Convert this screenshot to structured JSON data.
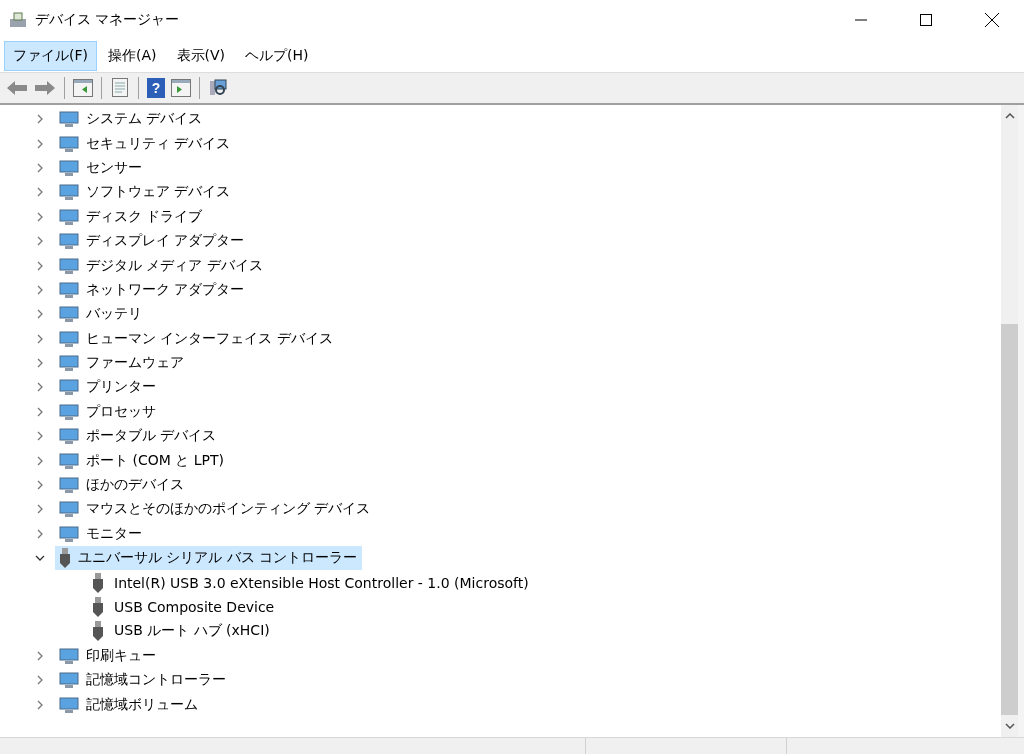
{
  "window": {
    "title": "デバイス マネージャー"
  },
  "toolbar": {
    "help_glyph": "?"
  },
  "menu": [
    {
      "label": "ファイル(F)",
      "selected": true
    },
    {
      "label": "操作(A)",
      "selected": false
    },
    {
      "label": "表示(V)",
      "selected": false
    },
    {
      "label": "ヘルプ(H)",
      "selected": false
    }
  ],
  "tree": [
    {
      "label": "システム デバイス",
      "expanded": false,
      "selected": false
    },
    {
      "label": "セキュリティ デバイス",
      "expanded": false,
      "selected": false
    },
    {
      "label": "センサー",
      "expanded": false,
      "selected": false
    },
    {
      "label": "ソフトウェア デバイス",
      "expanded": false,
      "selected": false
    },
    {
      "label": "ディスク ドライブ",
      "expanded": false,
      "selected": false
    },
    {
      "label": "ディスプレイ アダプター",
      "expanded": false,
      "selected": false
    },
    {
      "label": "デジタル メディア デバイス",
      "expanded": false,
      "selected": false
    },
    {
      "label": "ネットワーク アダプター",
      "expanded": false,
      "selected": false
    },
    {
      "label": "バッテリ",
      "expanded": false,
      "selected": false
    },
    {
      "label": "ヒューマン インターフェイス デバイス",
      "expanded": false,
      "selected": false
    },
    {
      "label": "ファームウェア",
      "expanded": false,
      "selected": false
    },
    {
      "label": "プリンター",
      "expanded": false,
      "selected": false
    },
    {
      "label": "プロセッサ",
      "expanded": false,
      "selected": false
    },
    {
      "label": "ポータブル デバイス",
      "expanded": false,
      "selected": false
    },
    {
      "label": "ポート (COM と LPT)",
      "expanded": false,
      "selected": false
    },
    {
      "label": "ほかのデバイス",
      "expanded": false,
      "selected": false
    },
    {
      "label": "マウスとそのほかのポインティング デバイス",
      "expanded": false,
      "selected": false
    },
    {
      "label": "モニター",
      "expanded": false,
      "selected": false
    },
    {
      "label": "ユニバーサル シリアル バス コントローラー",
      "expanded": true,
      "selected": true,
      "children": [
        {
          "label": "Intel(R) USB 3.0 eXtensible Host Controller - 1.0 (Microsoft)",
          "selected": false
        },
        {
          "label": "USB Composite Device",
          "selected": false
        },
        {
          "label": "USB ルート ハブ (xHCI)",
          "selected": false
        }
      ]
    },
    {
      "label": "印刷キュー",
      "expanded": false,
      "selected": false
    },
    {
      "label": "記憶域コントローラー",
      "expanded": false,
      "selected": false
    },
    {
      "label": "記憶域ボリューム",
      "expanded": false,
      "selected": false
    }
  ]
}
